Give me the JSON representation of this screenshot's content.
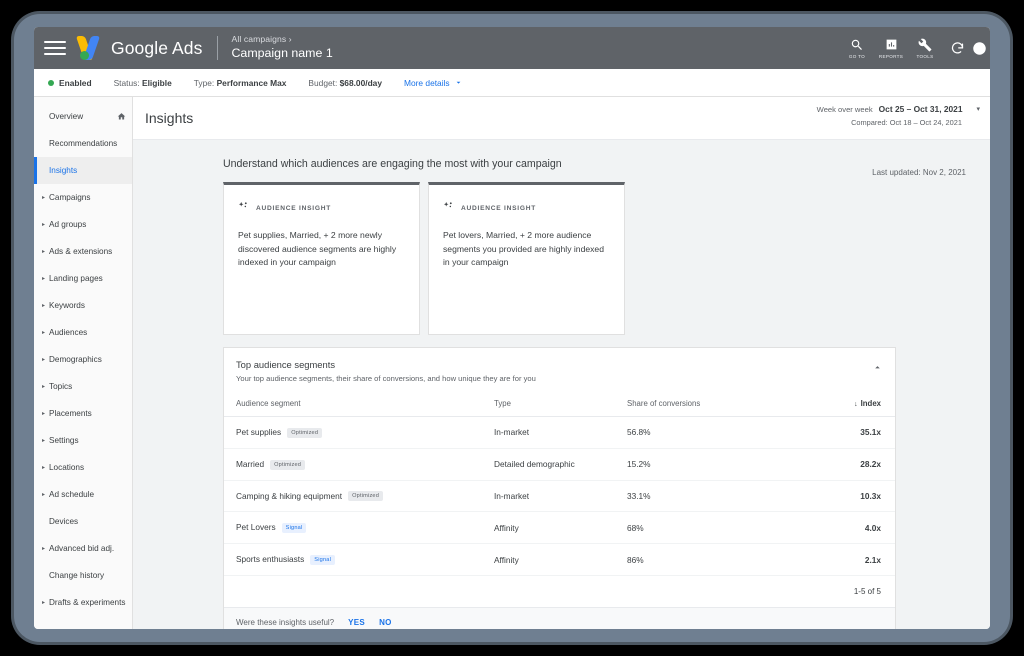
{
  "appbar": {
    "brand": "Google Ads",
    "breadcrumb_parent": "All campaigns  ›",
    "breadcrumb_current": "Campaign name 1",
    "tools": [
      {
        "icon": "search-icon",
        "label": "GO TO"
      },
      {
        "icon": "reports-bar-chart-icon",
        "label": "REPORTS"
      },
      {
        "icon": "tools-wrench-icon",
        "label": "TOOLS"
      }
    ],
    "refresh_icon": "refresh-icon",
    "help_icon": "help-icon",
    "bar_color": "#5f6368"
  },
  "statusbar": {
    "enabled_label": "Enabled",
    "status_key": "Status:",
    "status_value": "Eligible",
    "type_key": "Type:",
    "type_value": "Performance Max",
    "budget_key": "Budget:",
    "budget_value": "$68.00/day",
    "more_details": "More details",
    "enabled_color": "#34a853"
  },
  "sidebar": {
    "items": [
      {
        "label": "Overview",
        "expandable": false,
        "trailing_icon": "home-icon",
        "selected": false
      },
      {
        "label": "Recommendations",
        "expandable": false,
        "selected": false
      },
      {
        "label": "Insights",
        "expandable": false,
        "selected": true
      },
      {
        "label": "Campaigns",
        "expandable": true,
        "selected": false
      },
      {
        "label": "Ad groups",
        "expandable": true,
        "selected": false
      },
      {
        "label": "Ads & extensions",
        "expandable": true,
        "selected": false
      },
      {
        "label": "Landing pages",
        "expandable": true,
        "selected": false
      },
      {
        "label": "Keywords",
        "expandable": true,
        "selected": false
      },
      {
        "label": "Audiences",
        "expandable": true,
        "selected": false
      },
      {
        "label": "Demographics",
        "expandable": true,
        "selected": false
      },
      {
        "label": "Topics",
        "expandable": true,
        "selected": false
      },
      {
        "label": "Placements",
        "expandable": true,
        "selected": false
      },
      {
        "label": "Settings",
        "expandable": true,
        "selected": false
      },
      {
        "label": "Locations",
        "expandable": true,
        "selected": false
      },
      {
        "label": "Ad schedule",
        "expandable": true,
        "selected": false
      },
      {
        "label": "Devices",
        "expandable": false,
        "selected": false
      },
      {
        "label": "Advanced bid adj.",
        "expandable": true,
        "selected": false
      },
      {
        "label": "Change history",
        "expandable": false,
        "selected": false
      },
      {
        "label": "Drafts & experiments",
        "expandable": true,
        "selected": false
      }
    ],
    "selected_color": "#1a73e8"
  },
  "page": {
    "title": "Insights",
    "date_compare_label": "Week over week",
    "date_range": "Oct 25 – Oct 31, 2021",
    "date_compared": "Compared: Oct 18 – Oct 24, 2021",
    "headline": "Understand which audiences are engaging the most with your campaign",
    "last_updated": "Last updated: Nov 2, 2021"
  },
  "insight_cards": [
    {
      "kicker": "AUDIENCE INSIGHT",
      "icon": "sparkle-icon",
      "body": "Pet supplies, Married, + 2 more newly discovered audience segments are highly indexed in your campaign"
    },
    {
      "kicker": "AUDIENCE INSIGHT",
      "icon": "sparkle-icon",
      "body": "Pet lovers, Married, + 2 more audience segments you provided are highly indexed in your campaign"
    }
  ],
  "segments_panel": {
    "title": "Top audience segments",
    "subtitle": "Your top audience segments, their share of conversions, and how unique they are for you",
    "collapse_icon": "chevron-up-icon",
    "columns": [
      "Audience segment",
      "Type",
      "Share of conversions",
      "Index"
    ],
    "sort_column": "Index",
    "sort_direction": "descending",
    "rows": [
      {
        "segment": "Pet supplies",
        "badge": "Optimized",
        "badge_type": "optimized",
        "type": "In-market",
        "share": "56.8%",
        "index": "35.1x"
      },
      {
        "segment": "Married",
        "badge": "Optimized",
        "badge_type": "optimized",
        "type": "Detailed demographic",
        "share": "15.2%",
        "index": "28.2x"
      },
      {
        "segment": "Camping & hiking equipment",
        "badge": "Optimized",
        "badge_type": "optimized",
        "type": "In-market",
        "share": "33.1%",
        "index": "10.3x"
      },
      {
        "segment": "Pet Lovers",
        "badge": "Signal",
        "badge_type": "signal",
        "type": "Affinity",
        "share": "68%",
        "index": "4.0x"
      },
      {
        "segment": "Sports enthusiasts",
        "badge": "Signal",
        "badge_type": "signal",
        "type": "Affinity",
        "share": "86%",
        "index": "2.1x"
      }
    ],
    "pager": "1-5 of 5",
    "feedback_question": "Were these insights useful?",
    "feedback_yes": "YES",
    "feedback_no": "NO"
  }
}
